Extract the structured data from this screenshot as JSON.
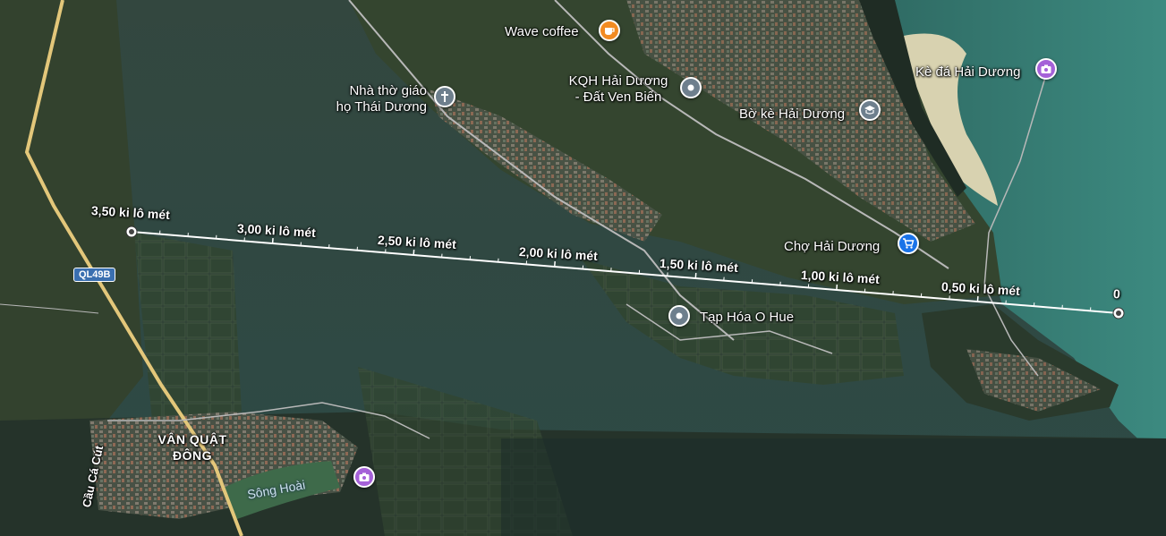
{
  "places": {
    "wave_coffee": "Wave coffee",
    "church_line1": "Nhà thờ giáo",
    "church_line2": "họ Thái Dương",
    "kqh_line1": "KQH Hải Dương",
    "kqh_line2": "- Đất Ven Biển",
    "bo_ke": "Bờ kè Hải Dương",
    "ke_da": "Kè đá Hải Dương",
    "cho": "Chợ Hải Dương",
    "tap_hoa": "Tạp Hóa O Hue",
    "van_quat_line1": "VÂN QUẬT",
    "van_quat_line2": "ĐÔNG",
    "song_hoai": "Sông Hoài",
    "cau_ca_cut": "Cầu Cá Cút"
  },
  "road_shield": "QL49B",
  "measure": {
    "labels": [
      "3,50 ki lô mét",
      "3,00 ki lô mét",
      "2,50 ki lô mét",
      "2,00 ki lô mét",
      "1,50 ki lô mét",
      "1,00 ki lô mét",
      "0,50 ki lô mét",
      "0"
    ],
    "distances_km": [
      3.5,
      3.0,
      2.5,
      2.0,
      1.5,
      1.0,
      0.5,
      0
    ],
    "total_km": 3.5
  },
  "colors": {
    "water": "#2a4d4a",
    "sea_light": "#3d8a80",
    "land": "#3b4a30",
    "road": "#b8b8b8",
    "highway": "#e3c77a",
    "pin_orange": "#f28b22",
    "pin_gray": "#6e7f8d",
    "pin_purple": "#a561d8",
    "pin_blue": "#1a73e8",
    "measure_line": "#ffffff"
  },
  "icons": {
    "wave_coffee": "coffee-icon",
    "church": "cross-icon",
    "kqh": "location-icon",
    "bo_ke": "school-icon",
    "ke_da": "camera-icon",
    "cho": "shopping-cart-icon",
    "tap_hoa": "location-icon",
    "song_hoai_pin": "camera-icon"
  }
}
